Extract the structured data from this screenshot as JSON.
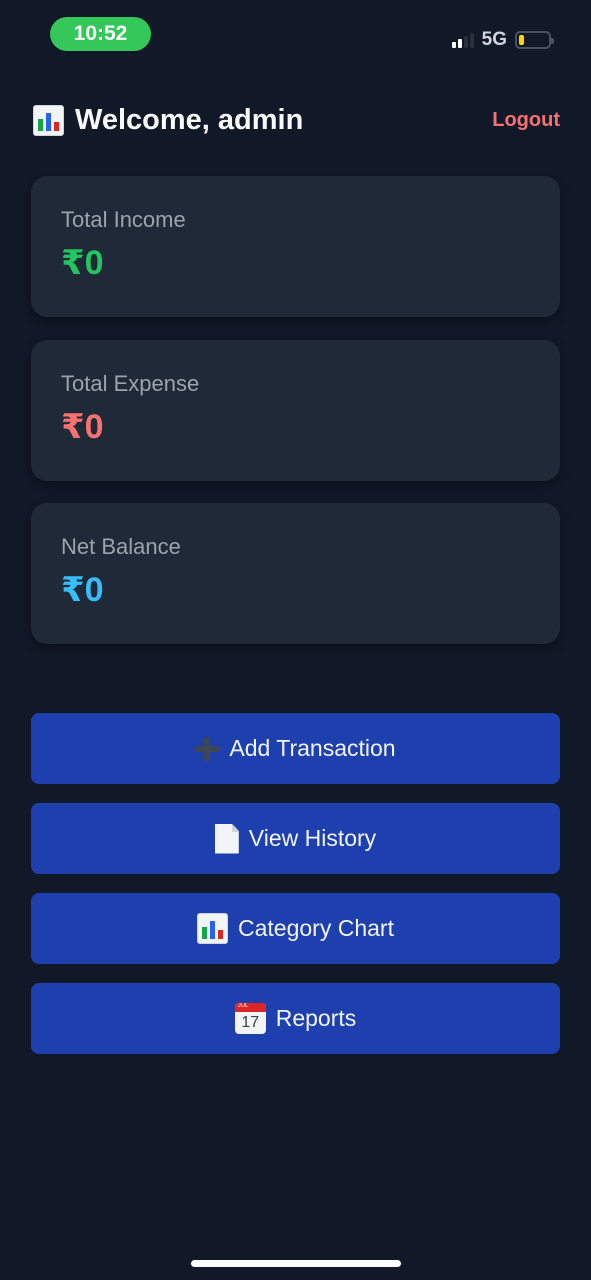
{
  "status_bar": {
    "time": "10:52",
    "network": "5G"
  },
  "header": {
    "welcome": "Welcome, admin",
    "logout": "Logout"
  },
  "cards": {
    "income": {
      "label": "Total Income",
      "value": "₹0"
    },
    "expense": {
      "label": "Total Expense",
      "value": "₹0"
    },
    "balance": {
      "label": "Net Balance",
      "value": "₹0"
    }
  },
  "actions": {
    "add": "Add Transaction",
    "history": "View History",
    "chart": "Category Chart",
    "reports": "Reports"
  },
  "calendar_icon": {
    "month": "JUL",
    "day": "17"
  },
  "colors": {
    "background": "#111827",
    "card": "#1f2937",
    "button": "#1e40af",
    "income": "#22c55e",
    "expense": "#f87171",
    "balance": "#38bdf8",
    "logout": "#f87171"
  },
  "icons": {
    "header": "bar-chart-icon",
    "add": "plus-icon",
    "history": "document-icon",
    "chart": "bar-chart-icon",
    "reports": "calendar-icon"
  }
}
